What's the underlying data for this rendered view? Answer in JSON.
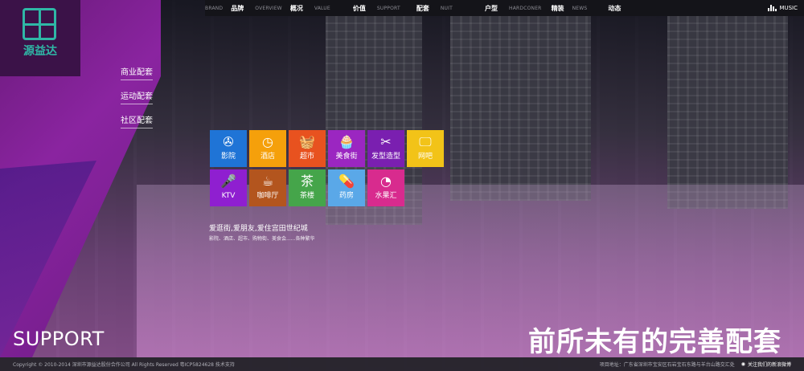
{
  "logo": {
    "text": "源益达"
  },
  "nav": [
    {
      "en": "BRAND",
      "cn": "品牌"
    },
    {
      "en": "OVERVIEW",
      "cn": "概况"
    },
    {
      "en": "VALUE",
      "cn": "价值"
    },
    {
      "en": "SUPPORT",
      "cn": "配套"
    },
    {
      "en": "NUIT",
      "cn": "户型"
    },
    {
      "en": "HARDCONER",
      "cn": "精装"
    },
    {
      "en": "NEWS",
      "cn": "动态"
    }
  ],
  "music": {
    "label": "MUSIC"
  },
  "sidebar": {
    "items": [
      "商业配套",
      "运动配套",
      "社区配套"
    ]
  },
  "tiles": [
    {
      "label": "影院",
      "icon": "film-reel-icon",
      "glyph": "✇",
      "color": "#1f74d6"
    },
    {
      "label": "酒店",
      "icon": "clock-icon",
      "glyph": "◷",
      "color": "#f5a00b"
    },
    {
      "label": "超市",
      "icon": "shopping-basket-icon",
      "glyph": "🧺",
      "color": "#e8521f"
    },
    {
      "label": "美食街",
      "icon": "cupcake-icon",
      "glyph": "🧁",
      "color": "#9b26c1"
    },
    {
      "label": "发型造型",
      "icon": "scissors-icon",
      "glyph": "✂",
      "color": "#7a1fb0"
    },
    {
      "label": "网吧",
      "icon": "monitor-icon",
      "glyph": "🖵",
      "color": "#f2c318"
    },
    {
      "label": "KTV",
      "icon": "microphone-icon",
      "glyph": "🎤",
      "color": "#8f1fd0"
    },
    {
      "label": "咖啡厅",
      "icon": "coffee-cup-icon",
      "glyph": "☕",
      "color": "#b3551e"
    },
    {
      "label": "茶楼",
      "icon": "tea-icon",
      "glyph": "茶",
      "color": "#45a54a"
    },
    {
      "label": "药房",
      "icon": "pill-icon",
      "glyph": "💊",
      "color": "#5aa8e8"
    },
    {
      "label": "水果汇",
      "icon": "pacman-icon",
      "glyph": "◔",
      "color": "#d82b8e"
    }
  ],
  "slogan": {
    "line1": "爱逛街,爱朋友,爱住宫田世纪城",
    "line2": "影院、酒店、超市、购物街、美食会......各种繁华"
  },
  "section": {
    "en": "SUPPORT",
    "headline": "前所未有的完善配套"
  },
  "footer": {
    "copyright": "Copyright © 2010-2014 深圳市源益达股份合作公司 All Rights Reserved 粤ICP5824628 技术支持",
    "address": "项目地址：广东省深圳市宝安区石岩宝石东路与羊台山路交汇处",
    "weibo": "关注我们的新浪微博"
  }
}
